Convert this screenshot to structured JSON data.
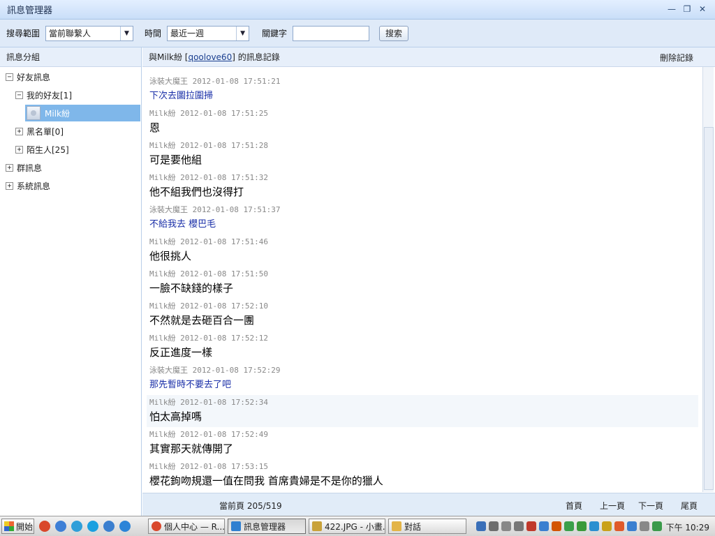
{
  "window": {
    "title": "訊息管理器",
    "minimize_glyph": "—",
    "restore_glyph": "❐",
    "close_glyph": "✕"
  },
  "search": {
    "range_label": "搜尋範圍",
    "range_value": "當前聯繫人",
    "time_label": "時間",
    "time_value": "最近一週",
    "keyword_label": "關鍵字",
    "keyword_value": "",
    "search_button": "搜索"
  },
  "sidebar": {
    "header": "訊息分組",
    "tree": [
      {
        "label": "好友訊息",
        "expander": "−"
      },
      {
        "label": "我的好友[1]",
        "expander": "−"
      },
      {
        "label": "Milk紛",
        "selected": true
      },
      {
        "label": "黑名單[0]",
        "expander": "+"
      },
      {
        "label": "陌生人[25]",
        "expander": "+"
      },
      {
        "label": "群訊息",
        "expander": "+"
      },
      {
        "label": "系統訊息",
        "expander": "+"
      }
    ]
  },
  "chat": {
    "header_prefix": "與Milk紛 [",
    "contact_id": "qoolove60",
    "header_suffix": "] 的訊息記錄",
    "delete_label": "刪除記錄",
    "messages": [
      {
        "sender": "泳裝大魔王",
        "time": "2012-01-08 17:51:21",
        "text": "下次去圖拉圍掃",
        "self": true
      },
      {
        "sender": "Milk紛",
        "time": "2012-01-08 17:51:25",
        "text": "恩",
        "self": false
      },
      {
        "sender": "Milk紛",
        "time": "2012-01-08 17:51:28",
        "text": "可是要他組",
        "self": false
      },
      {
        "sender": "Milk紛",
        "time": "2012-01-08 17:51:32",
        "text": "他不組我們也沒得打",
        "self": false
      },
      {
        "sender": "泳裝大魔王",
        "time": "2012-01-08 17:51:37",
        "text": "不給我去  櫻巴毛",
        "self": true
      },
      {
        "sender": "Milk紛",
        "time": "2012-01-08 17:51:46",
        "text": "他很挑人",
        "self": false
      },
      {
        "sender": "Milk紛",
        "time": "2012-01-08 17:51:50",
        "text": "一臉不缺錢的樣子",
        "self": false
      },
      {
        "sender": "Milk紛",
        "time": "2012-01-08 17:52:10",
        "text": "不然就是去砸百合一團",
        "self": false
      },
      {
        "sender": "Milk紛",
        "time": "2012-01-08 17:52:12",
        "text": "反正進度一樣",
        "self": false
      },
      {
        "sender": "泳裝大魔王",
        "time": "2012-01-08 17:52:29",
        "text": "那先暫時不要去了吧",
        "self": true
      },
      {
        "sender": "Milk紛",
        "time": "2012-01-08 17:52:34",
        "text": "怕太高掉嗎",
        "self": false,
        "highlight": true
      },
      {
        "sender": "Milk紛",
        "time": "2012-01-08 17:52:49",
        "text": "其實那天就傳開了",
        "self": false
      },
      {
        "sender": "Milk紛",
        "time": "2012-01-08 17:53:15",
        "text": "櫻花鉤吻規還一值在問我 首席貴婦是不是你的獵人",
        "self": false
      }
    ]
  },
  "pager": {
    "current_page": "當前頁 205/519",
    "first": "首頁",
    "prev": "上一頁",
    "next": "下一頁",
    "last": "尾頁"
  },
  "taskbar": {
    "start_label": "開始",
    "tasks": [
      {
        "label": "個人中心 — R...",
        "icon_color": "#d9472b",
        "active": false
      },
      {
        "label": "訊息管理器",
        "icon_color": "#2f7fd0",
        "active": true
      },
      {
        "label": "422.JPG - 小畫...",
        "icon_color": "#c9a23a",
        "active": false
      },
      {
        "label": "對話",
        "icon_color": "#e3b447",
        "active": false
      }
    ],
    "quick_launch_colors": [
      "#d9472b",
      "#3e7fd6",
      "#2f9fd9",
      "#1aa0e0",
      "#3b7fcf",
      "#2b84d8"
    ],
    "tray_colors": [
      "#3a6fb8",
      "#6d6d6d",
      "#888888",
      "#777777",
      "#c0392b",
      "#3a7fd0",
      "#d35400",
      "#3aa04a",
      "#3a9a3a",
      "#2a8fd0",
      "#c9a11a",
      "#e05a2a",
      "#3a7fd0",
      "#888888",
      "#3a9a4a"
    ],
    "clock": "下午 10:29"
  }
}
